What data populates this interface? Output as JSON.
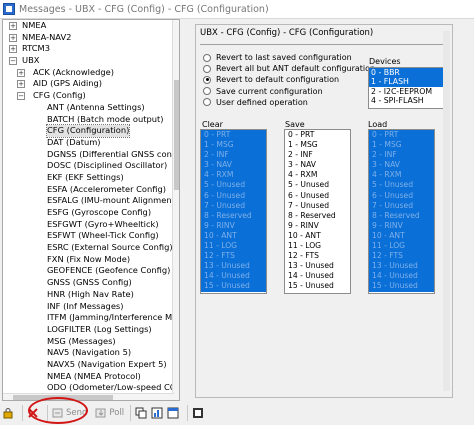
{
  "window": {
    "title": "Messages - UBX - CFG (Config) - CFG (Configuration)"
  },
  "tree": {
    "rows": [
      {
        "label": "NMEA",
        "expander": "+",
        "level": 0
      },
      {
        "label": "NMEA-NAV2",
        "expander": "+",
        "level": 0
      },
      {
        "label": "RTCM3",
        "expander": "+",
        "level": 0
      },
      {
        "label": "UBX",
        "expander": "−",
        "level": 0
      },
      {
        "label": "ACK (Acknowledge)",
        "expander": "+",
        "level": 1
      },
      {
        "label": "AID (GPS Aiding)",
        "expander": "+",
        "level": 1
      },
      {
        "label": "CFG (Config)",
        "expander": "−",
        "level": 1
      },
      {
        "label": "ANT (Antenna Settings)",
        "level": 2
      },
      {
        "label": "BATCH (Batch mode output)",
        "level": 2
      },
      {
        "label": "CFG (Configuration)",
        "level": 2,
        "selected": true
      },
      {
        "label": "DAT (Datum)",
        "level": 2
      },
      {
        "label": "DGNSS (Differential GNSS configuratio",
        "level": 2
      },
      {
        "label": "DOSC (Disciplined Oscillator)",
        "level": 2
      },
      {
        "label": "EKF (EKF Settings)",
        "level": 2
      },
      {
        "label": "ESFA (Accelerometer Config)",
        "level": 2
      },
      {
        "label": "ESFALG (IMU-mount Alignment)",
        "level": 2
      },
      {
        "label": "ESFG (Gyroscope Config)",
        "level": 2
      },
      {
        "label": "ESFGWT (Gyro+Wheeltick)",
        "level": 2
      },
      {
        "label": "ESFWT (Wheel-Tick Config)",
        "level": 2
      },
      {
        "label": "ESRC (External Source Config)",
        "level": 2
      },
      {
        "label": "FXN (Fix Now Mode)",
        "level": 2
      },
      {
        "label": "GEOFENCE (Geofence Config)",
        "level": 2
      },
      {
        "label": "GNSS (GNSS Config)",
        "level": 2
      },
      {
        "label": "HNR (High Nav Rate)",
        "level": 2
      },
      {
        "label": "INF (Inf Messages)",
        "level": 2
      },
      {
        "label": "ITFM (Jamming/Interference Monitor)",
        "level": 2
      },
      {
        "label": "LOGFILTER (Log Settings)",
        "level": 2
      },
      {
        "label": "MSG (Messages)",
        "level": 2
      },
      {
        "label": "NAV5 (Navigation 5)",
        "level": 2
      },
      {
        "label": "NAVX5 (Navigation Expert 5)",
        "level": 2
      },
      {
        "label": "NMEA (NMEA Protocol)",
        "level": 2
      },
      {
        "label": "ODO (Odometer/Low-speed COG filter)",
        "level": 2
      }
    ]
  },
  "toolbar": {
    "send_label": "Send",
    "poll_label": "Poll"
  },
  "panel": {
    "caption": "UBX - CFG (Config) - CFG (Configuration)",
    "options": [
      {
        "label": "Revert to last saved configuration",
        "checked": false
      },
      {
        "label": "Revert all but ANT default configuration",
        "checked": false
      },
      {
        "label": "Revert to default configuration",
        "checked": true
      },
      {
        "label": "Save current configuration",
        "checked": false
      },
      {
        "label": "User defined operation",
        "checked": false
      }
    ],
    "devices_title": "Devices",
    "devices": [
      {
        "label": "0 - BBR",
        "selected": true
      },
      {
        "label": "1 - FLASH",
        "selected": true
      },
      {
        "label": "2 - I2C-EEPROM",
        "selected": false
      },
      {
        "label": "4 - SPI-FLASH",
        "selected": false
      }
    ],
    "clear_title": "Clear",
    "save_title": "Save",
    "load_title": "Load",
    "sections": [
      "0 - PRT",
      "1 - MSG",
      "2 - INF",
      "3 - NAV",
      "4 - RXM",
      "5 - Unused",
      "6 - Unused",
      "7 - Unused",
      "8 - Reserved",
      "9 - RINV",
      "10 - ANT",
      "11 - LOG",
      "12 - FTS",
      "13 - Unused",
      "14 - Unused",
      "15 - Unused"
    ]
  }
}
